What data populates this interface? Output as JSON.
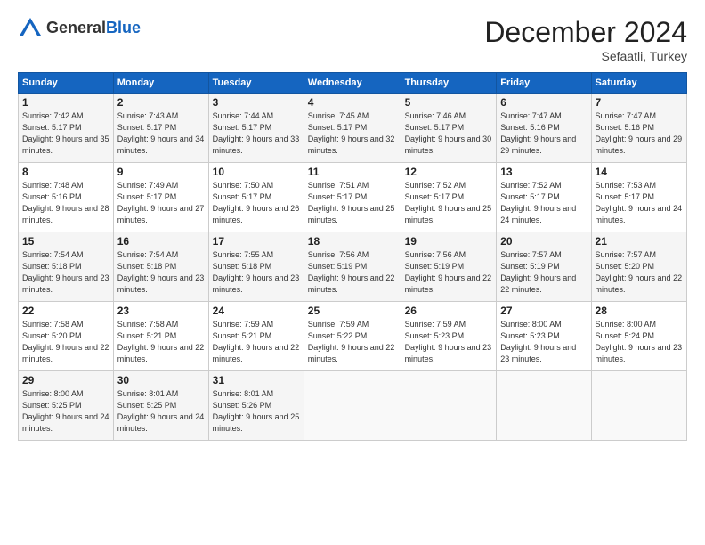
{
  "logo": {
    "general": "General",
    "blue": "Blue"
  },
  "header": {
    "month": "December 2024",
    "location": "Sefaatli, Turkey"
  },
  "weekdays": [
    "Sunday",
    "Monday",
    "Tuesday",
    "Wednesday",
    "Thursday",
    "Friday",
    "Saturday"
  ],
  "weeks": [
    [
      {
        "day": "1",
        "info": "Sunrise: 7:42 AM\nSunset: 5:17 PM\nDaylight: 9 hours and 35 minutes."
      },
      {
        "day": "2",
        "info": "Sunrise: 7:43 AM\nSunset: 5:17 PM\nDaylight: 9 hours and 34 minutes."
      },
      {
        "day": "3",
        "info": "Sunrise: 7:44 AM\nSunset: 5:17 PM\nDaylight: 9 hours and 33 minutes."
      },
      {
        "day": "4",
        "info": "Sunrise: 7:45 AM\nSunset: 5:17 PM\nDaylight: 9 hours and 32 minutes."
      },
      {
        "day": "5",
        "info": "Sunrise: 7:46 AM\nSunset: 5:17 PM\nDaylight: 9 hours and 30 minutes."
      },
      {
        "day": "6",
        "info": "Sunrise: 7:47 AM\nSunset: 5:16 PM\nDaylight: 9 hours and 29 minutes."
      },
      {
        "day": "7",
        "info": "Sunrise: 7:47 AM\nSunset: 5:16 PM\nDaylight: 9 hours and 29 minutes."
      }
    ],
    [
      {
        "day": "8",
        "info": "Sunrise: 7:48 AM\nSunset: 5:16 PM\nDaylight: 9 hours and 28 minutes."
      },
      {
        "day": "9",
        "info": "Sunrise: 7:49 AM\nSunset: 5:17 PM\nDaylight: 9 hours and 27 minutes."
      },
      {
        "day": "10",
        "info": "Sunrise: 7:50 AM\nSunset: 5:17 PM\nDaylight: 9 hours and 26 minutes."
      },
      {
        "day": "11",
        "info": "Sunrise: 7:51 AM\nSunset: 5:17 PM\nDaylight: 9 hours and 25 minutes."
      },
      {
        "day": "12",
        "info": "Sunrise: 7:52 AM\nSunset: 5:17 PM\nDaylight: 9 hours and 25 minutes."
      },
      {
        "day": "13",
        "info": "Sunrise: 7:52 AM\nSunset: 5:17 PM\nDaylight: 9 hours and 24 minutes."
      },
      {
        "day": "14",
        "info": "Sunrise: 7:53 AM\nSunset: 5:17 PM\nDaylight: 9 hours and 24 minutes."
      }
    ],
    [
      {
        "day": "15",
        "info": "Sunrise: 7:54 AM\nSunset: 5:18 PM\nDaylight: 9 hours and 23 minutes."
      },
      {
        "day": "16",
        "info": "Sunrise: 7:54 AM\nSunset: 5:18 PM\nDaylight: 9 hours and 23 minutes."
      },
      {
        "day": "17",
        "info": "Sunrise: 7:55 AM\nSunset: 5:18 PM\nDaylight: 9 hours and 23 minutes."
      },
      {
        "day": "18",
        "info": "Sunrise: 7:56 AM\nSunset: 5:19 PM\nDaylight: 9 hours and 22 minutes."
      },
      {
        "day": "19",
        "info": "Sunrise: 7:56 AM\nSunset: 5:19 PM\nDaylight: 9 hours and 22 minutes."
      },
      {
        "day": "20",
        "info": "Sunrise: 7:57 AM\nSunset: 5:19 PM\nDaylight: 9 hours and 22 minutes."
      },
      {
        "day": "21",
        "info": "Sunrise: 7:57 AM\nSunset: 5:20 PM\nDaylight: 9 hours and 22 minutes."
      }
    ],
    [
      {
        "day": "22",
        "info": "Sunrise: 7:58 AM\nSunset: 5:20 PM\nDaylight: 9 hours and 22 minutes."
      },
      {
        "day": "23",
        "info": "Sunrise: 7:58 AM\nSunset: 5:21 PM\nDaylight: 9 hours and 22 minutes."
      },
      {
        "day": "24",
        "info": "Sunrise: 7:59 AM\nSunset: 5:21 PM\nDaylight: 9 hours and 22 minutes."
      },
      {
        "day": "25",
        "info": "Sunrise: 7:59 AM\nSunset: 5:22 PM\nDaylight: 9 hours and 22 minutes."
      },
      {
        "day": "26",
        "info": "Sunrise: 7:59 AM\nSunset: 5:23 PM\nDaylight: 9 hours and 23 minutes."
      },
      {
        "day": "27",
        "info": "Sunrise: 8:00 AM\nSunset: 5:23 PM\nDaylight: 9 hours and 23 minutes."
      },
      {
        "day": "28",
        "info": "Sunrise: 8:00 AM\nSunset: 5:24 PM\nDaylight: 9 hours and 23 minutes."
      }
    ],
    [
      {
        "day": "29",
        "info": "Sunrise: 8:00 AM\nSunset: 5:25 PM\nDaylight: 9 hours and 24 minutes."
      },
      {
        "day": "30",
        "info": "Sunrise: 8:01 AM\nSunset: 5:25 PM\nDaylight: 9 hours and 24 minutes."
      },
      {
        "day": "31",
        "info": "Sunrise: 8:01 AM\nSunset: 5:26 PM\nDaylight: 9 hours and 25 minutes."
      },
      null,
      null,
      null,
      null
    ]
  ]
}
